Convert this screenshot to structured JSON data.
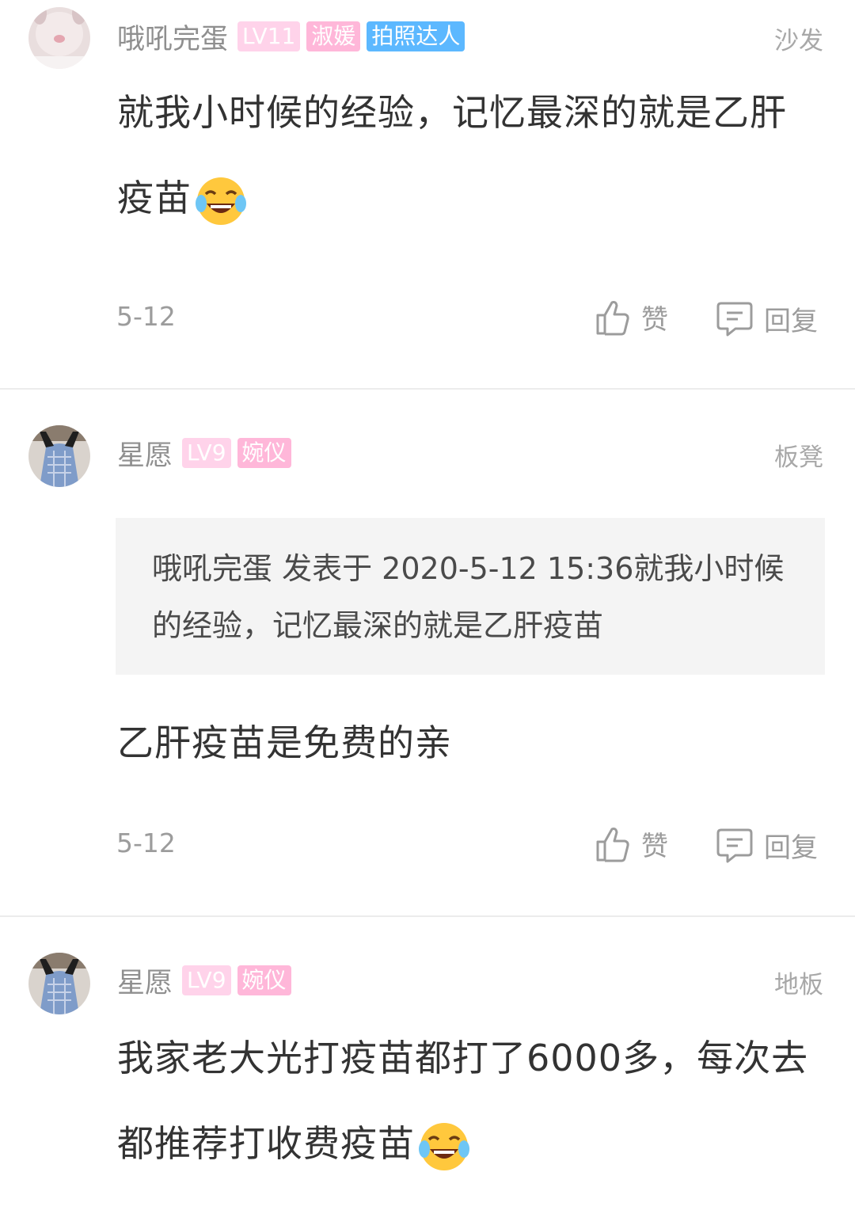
{
  "comments": [
    {
      "username": "哦吼完蛋",
      "badges": [
        "LV11",
        "淑媛",
        "拍照达人"
      ],
      "floor": "沙发",
      "text": "就我小时候的经验，记忆最深的就是乙肝疫苗",
      "emoji": "laughing-crying-emoji",
      "date": "5-12",
      "like_label": "赞",
      "reply_label": "回复"
    },
    {
      "username": "星愿",
      "badges": [
        "LV9",
        "婉仪"
      ],
      "floor": "板凳",
      "quote": "哦吼完蛋 发表于 2020-5-12 15:36就我小时候的经验，记忆最深的就是乙肝疫苗",
      "text": "乙肝疫苗是免费的亲",
      "date": "5-12",
      "like_label": "赞",
      "reply_label": "回复"
    },
    {
      "username": "星愿",
      "badges": [
        "LV9",
        "婉仪"
      ],
      "floor": "地板",
      "text": "我家老大光打疫苗都打了6000多，每次去都推荐打收费疫苗",
      "emoji": "laughing-crying-emoji"
    }
  ],
  "colors": {
    "username": "#8f8f8f",
    "badge_level": "#ffd3ea",
    "badge_title": "#ffb7d9",
    "badge_special": "#5cb8ff",
    "divider": "#ececec",
    "quote_bg": "#f4f4f4"
  },
  "icons": [
    "thumbs-up-icon",
    "comment-bubble-icon",
    "laughing-crying-emoji"
  ]
}
